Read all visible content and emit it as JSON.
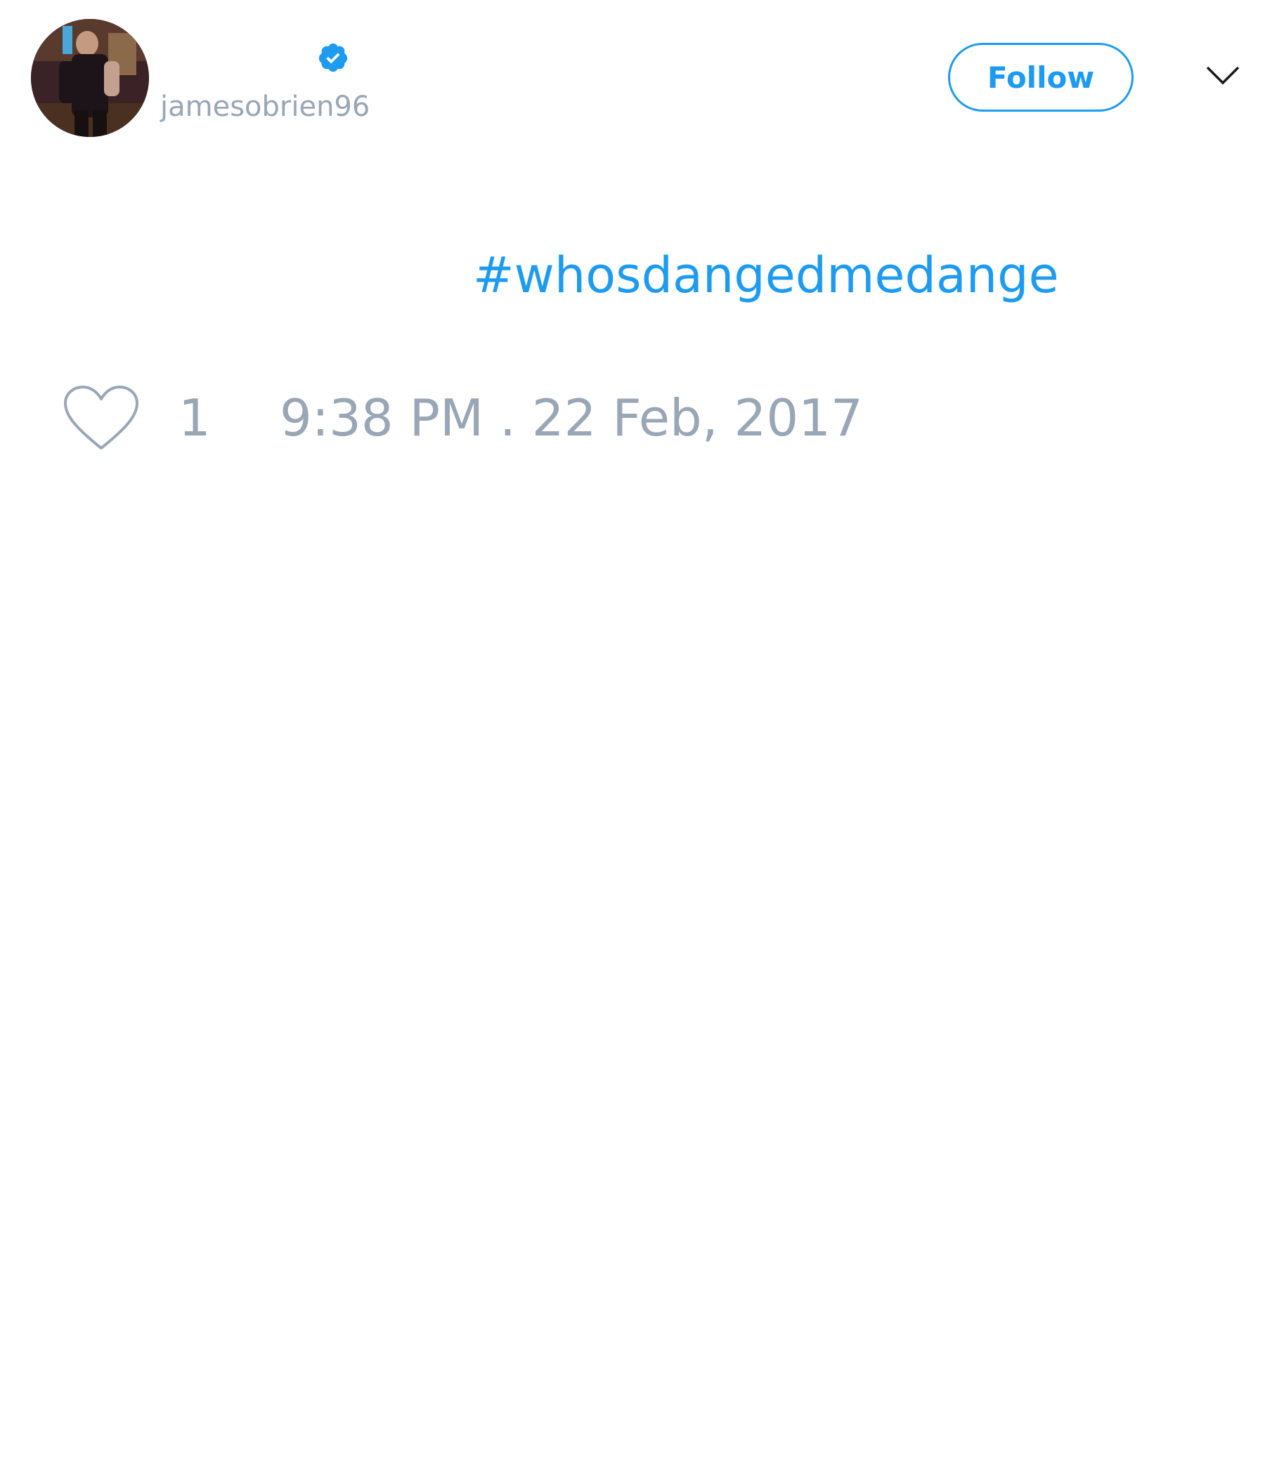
{
  "header": {
    "handle": "jamesobrien96",
    "verified": true,
    "follow_label": "Follow",
    "menu_icon": "chevron-down-icon",
    "avatar_icon": "user-avatar"
  },
  "tweet": {
    "text": "#whosdangedmedange",
    "like_icon": "heart-outline-icon",
    "like_count": "1",
    "timestamp": "9:38 PM . 22 Feb, 2017"
  },
  "colors": {
    "accent": "#1d9bf0",
    "muted_text": "#98a6b6",
    "background": "#ffffff"
  }
}
